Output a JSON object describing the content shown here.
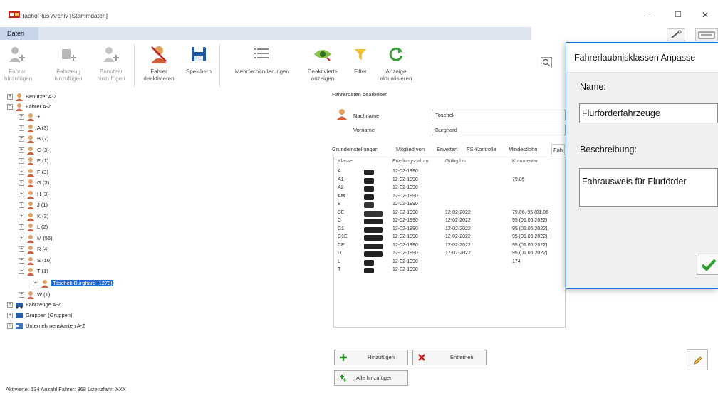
{
  "window": {
    "title": "TachoPlus-Archiv [Stammdaten]",
    "minimize": "–",
    "maximize": "☐",
    "close": "✕"
  },
  "menu": {
    "daten": "Daten"
  },
  "toolbar": {
    "fahrer_hinzufuegen": "Fahrer hinzufügen",
    "fahrzeug_hinzufuegen": "Fahrzeug hinzufügen",
    "benutzer_hinzufuegen": "Benutzer hinzufügen",
    "fahrer_deaktivieren": "Fahrer deaktivieren",
    "speichern": "Speichern",
    "mehrfachaenderungen": "Mehrfachänderungen",
    "deaktivierte_anzeigen": "Deaktivierte anzeigen",
    "filter": "Filter",
    "anzeige_aktualisieren": "Anzeige aktualisieren"
  },
  "tree": {
    "benutzer": "Benutzer A-Z",
    "fahrer": "Fahrer A-Z",
    "letters": [
      "+",
      "A (3)",
      "B (7)",
      "C (3)",
      "E (1)",
      "F (3)",
      "G (3)",
      "H (3)",
      "J (1)",
      "K (3)",
      "L (2)",
      "M (56)",
      "R (4)",
      "S (10)",
      "T (1)"
    ],
    "selected": "Toschek Burghard [1270]",
    "w": "W (1)",
    "fahrzeuge": "Fahrzeuge A-Z",
    "gruppen": "Gruppen (Gruppen)",
    "unternehmenskarten": "Unternehmenskarten A-Z"
  },
  "status": {
    "text": "Aktivierte: 134  Anzahl Fahrer: 868  Lizenzfahr: XXX"
  },
  "details": {
    "title": "Fahrerdaten bearbeiten",
    "nachname_label": "Nachname",
    "nachname": "Toschek",
    "vorname_label": "Vorname",
    "vorname": "Burghard",
    "tabs": [
      "Grundeinstellungen",
      "Mitglied von",
      "Erweitert",
      "FS-Kontrolle",
      "Mindestlohn",
      "Fah"
    ]
  },
  "grid": {
    "headers": [
      "Klasse",
      "Erteilungsdatum",
      "Gültig bis",
      "Kommentar"
    ],
    "rows": [
      {
        "klasse": "A",
        "erteilt": "12-02-1990",
        "gueltig": "",
        "kommentar": ""
      },
      {
        "klasse": "A1",
        "erteilt": "12-02-1990",
        "gueltig": "",
        "kommentar": "79.05"
      },
      {
        "klasse": "A2",
        "erteilt": "12-02-1990",
        "gueltig": "",
        "kommentar": ""
      },
      {
        "klasse": "AM",
        "erteilt": "12-02-1990",
        "gueltig": "",
        "kommentar": ""
      },
      {
        "klasse": "B",
        "erteilt": "12-02-1990",
        "gueltig": "",
        "kommentar": ""
      },
      {
        "klasse": "BE",
        "erteilt": "12-02-1990",
        "gueltig": "12-02-2022",
        "kommentar": "79.06, 95 (01.06"
      },
      {
        "klasse": "C",
        "erteilt": "12-02-1990",
        "gueltig": "12-02-2022",
        "kommentar": "95 (01.06.2022),"
      },
      {
        "klasse": "C1",
        "erteilt": "12-02-1990",
        "gueltig": "12-02-2022",
        "kommentar": "95 (01.06.2022),"
      },
      {
        "klasse": "C1E",
        "erteilt": "12-02-1990",
        "gueltig": "12-02-2022",
        "kommentar": "95 (01.06.2022),"
      },
      {
        "klasse": "CE",
        "erteilt": "12-02-1990",
        "gueltig": "12-02-2022",
        "kommentar": "95 (01.06.2022)"
      },
      {
        "klasse": "D",
        "erteilt": "12-02-1990",
        "gueltig": "17-07-2022",
        "kommentar": "95 (01.06.2022)"
      },
      {
        "klasse": "L",
        "erteilt": "12-02-1990",
        "gueltig": "",
        "kommentar": "174"
      },
      {
        "klasse": "T",
        "erteilt": "12-02-1990",
        "gueltig": "",
        "kommentar": ""
      }
    ]
  },
  "buttons": {
    "hinzufuegen": "Hinzufügen",
    "entfernen": "Entfernen",
    "alle_hinzufuegen": "Alle hinzufügen"
  },
  "dialog": {
    "title": "Fahrerlaubnisklassen Anpasse",
    "name_label": "Name:",
    "name_value": "Flurförderfahrzeuge",
    "beschreibung_label": "Beschreibung:",
    "beschreibung_value": "Fahrausweis für Flurförder"
  },
  "colors": {
    "accent": "#1f6fd4",
    "selection": "#1e6ae0",
    "ok_green": "#2e9b2e",
    "remove_red": "#d42020"
  }
}
